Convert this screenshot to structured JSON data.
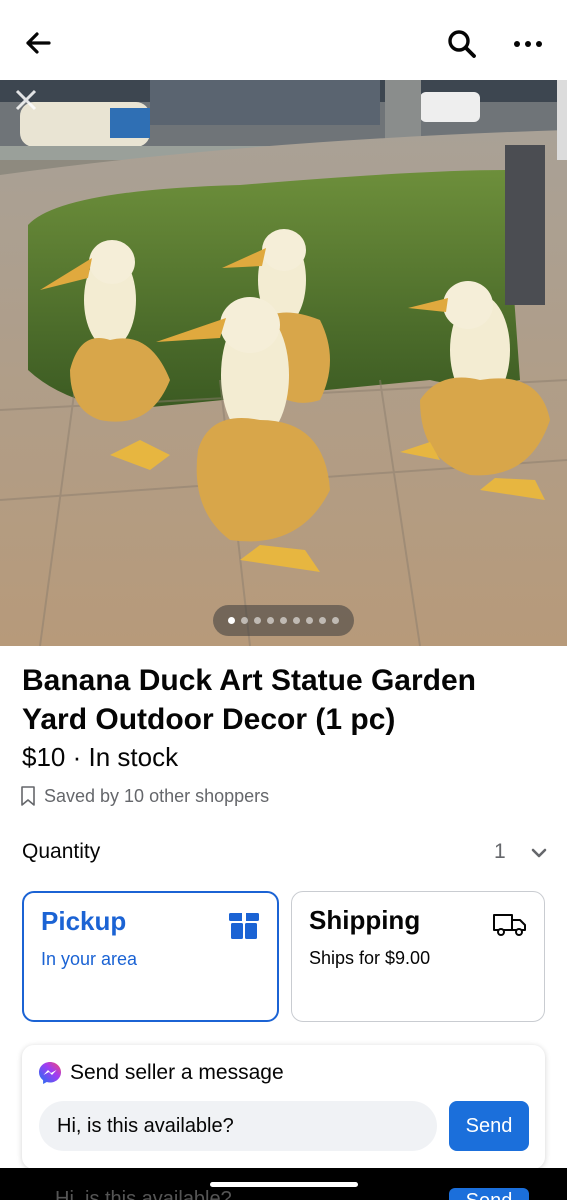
{
  "header": {
    "back_icon": "arrow-left-icon",
    "search_icon": "search-icon",
    "more_icon": "more-horizontal-icon"
  },
  "hero": {
    "photo_description_icon": "banana-duck-statues-photo",
    "carousel_count": 9,
    "carousel_active": 0
  },
  "listing": {
    "title": " Banana Duck Art Statue Garden Yard Outdoor Decor (1 pc)",
    "price_line": "$10 · In stock",
    "saved_text": "Saved by 10 other shoppers"
  },
  "quantity": {
    "label": "Quantity",
    "value": "1"
  },
  "delivery": {
    "pickup": {
      "title": "Pickup",
      "subtitle": "In your area"
    },
    "shipping": {
      "title": "Shipping",
      "subtitle": "Ships for $9.00"
    }
  },
  "message": {
    "header": "Send seller a message",
    "input_value": "Hi, is this available?",
    "send_label": "Send"
  },
  "ghost": {
    "input_value": "Hi, is this available?",
    "send_label": "Send"
  },
  "colors": {
    "accent": "#1b63d4",
    "send_button": "#1b6fdb",
    "secondary_text": "#65676b"
  }
}
